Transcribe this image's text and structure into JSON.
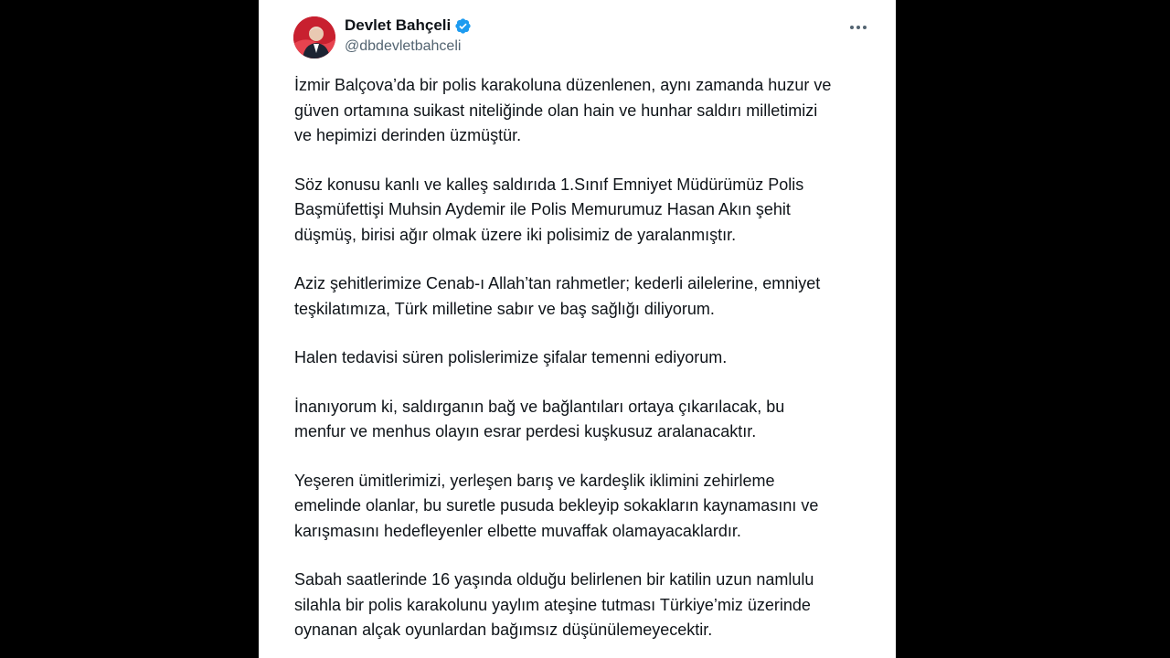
{
  "tweet": {
    "author": {
      "display_name": "Devlet Bahçeli",
      "handle": "@dbdevletbahceli",
      "verified": true,
      "verified_color": "#1d9bf0"
    },
    "more_icon": "more-horizontal-icon",
    "paragraphs": [
      "İzmir Balçova’da bir polis karakoluna düzenlenen, aynı zamanda huzur ve\ngüven ortamına suikast niteliğinde olan hain ve hunhar saldırı milletimizi\nve hepimizi derinden üzmüştür.",
      "Söz konusu kanlı ve kalleş saldırıda 1.Sınıf Emniyet Müdürümüz Polis\nBaşmüfettişi Muhsin Aydemir ile Polis Memurumuz Hasan Akın şehit\ndüşmüş, birisi ağır olmak üzere iki polisimiz de yaralanmıştır.",
      "Aziz şehitlerimize Cenab-ı Allah’tan rahmetler; kederli ailelerine, emniyet\nteşkilatımıza, Türk milletine sabır ve baş sağlığı diliyorum.",
      "Halen tedavisi süren polislerimize şifalar temenni ediyorum.",
      "İnanıyorum ki, saldırganın bağ ve bağlantıları ortaya çıkarılacak, bu\nmenfur ve menhus olayın esrar perdesi kuşkusuz aralanacaktır.",
      "Yeşeren ümitlerimizi, yerleşen barış ve kardeşlik iklimini zehirleme\nemelinde olanlar, bu suretle pusuda bekleyip sokakların kaynamasını ve\nkarışmasını hedefleyenler elbette muvaffak olamayacaklardır.",
      "Sabah saatlerinde 16 yaşında olduğu belirlenen bir katilin uzun namlulu\nsilahla bir polis karakolunu yaylım ateşine tutması Türkiye’miz üzerinde\noynanan alçak oyunlardan bağımsız düşünülemeyecektir."
    ]
  }
}
